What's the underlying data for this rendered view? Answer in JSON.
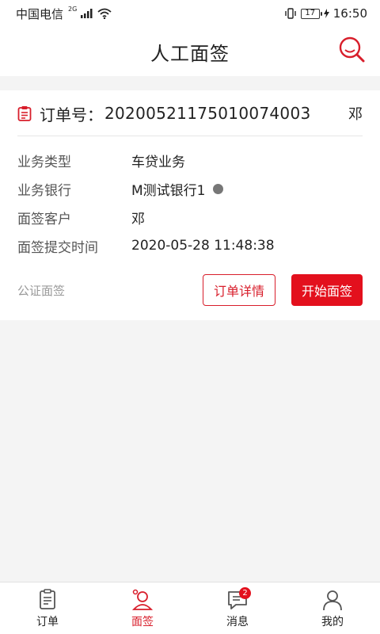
{
  "statusbar": {
    "carrier": "中国电信",
    "network": "2G",
    "battery": "17",
    "time": "16:50"
  },
  "header": {
    "title": "人工面签"
  },
  "order": {
    "label": "订单号：",
    "number": "20200521175010074003",
    "customer_short": "邓"
  },
  "details": [
    {
      "key": "业务类型",
      "value": "车贷业务"
    },
    {
      "key": "业务银行",
      "value": "M测试银行1"
    },
    {
      "key": "面签客户",
      "value": "邓"
    },
    {
      "key": "面签提交时间",
      "value": "2020-05-28 11:48:38"
    }
  ],
  "card_footer": {
    "tag": "公证面签",
    "detail_button": "订单详情",
    "start_button": "开始面签"
  },
  "tabs": [
    {
      "label": "订单",
      "icon": "order-icon"
    },
    {
      "label": "面签",
      "icon": "sign-icon",
      "active": true
    },
    {
      "label": "消息",
      "icon": "message-icon",
      "badge": "2"
    },
    {
      "label": "我的",
      "icon": "profile-icon"
    }
  ],
  "colors": {
    "accent": "#d81e2b",
    "button_fill": "#e3101d",
    "background": "#f4f4f4"
  }
}
